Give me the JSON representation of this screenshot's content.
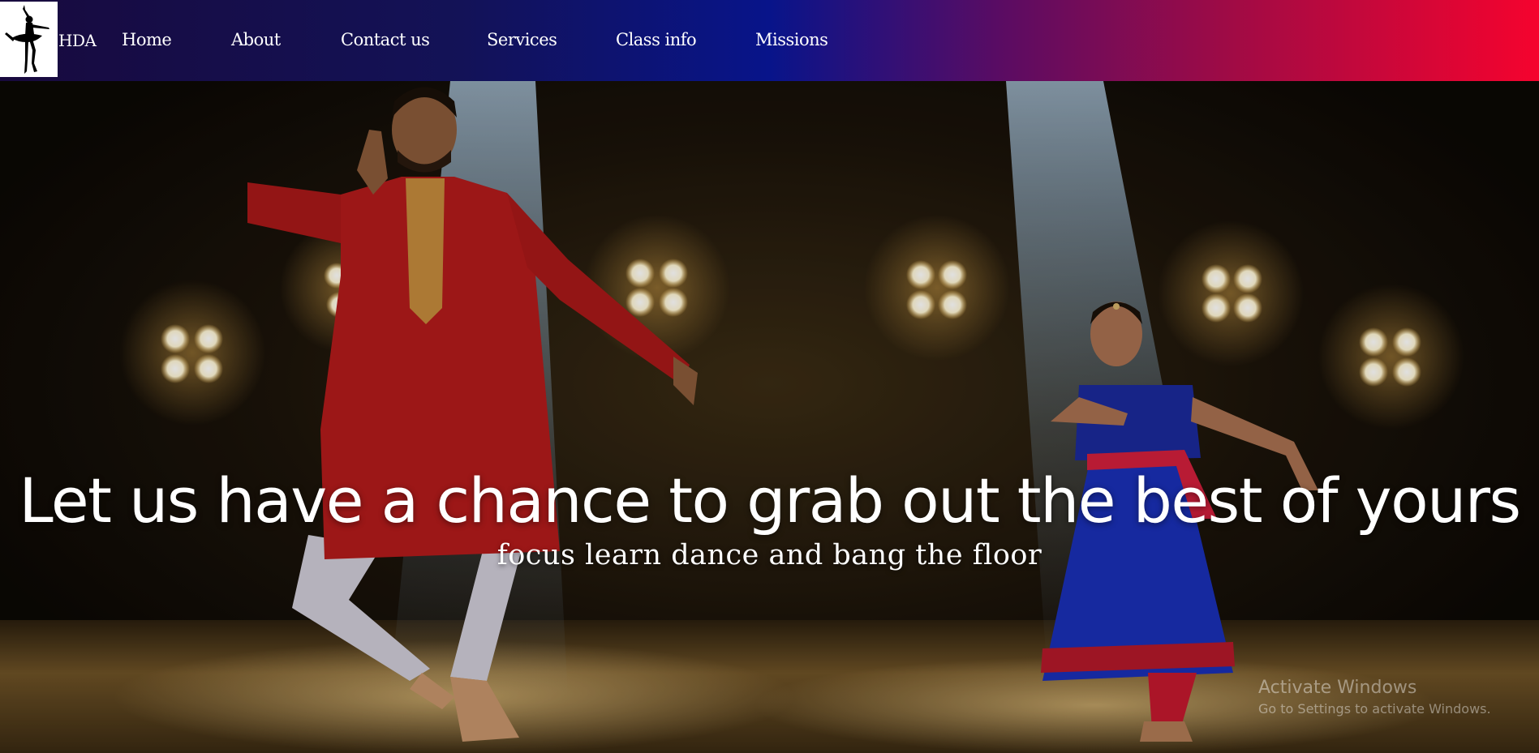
{
  "brand": {
    "logo_icon": "ballerina-silhouette-icon",
    "name": "HDA"
  },
  "nav": {
    "items": [
      {
        "label": "Home"
      },
      {
        "label": "About"
      },
      {
        "label": "Contact us"
      },
      {
        "label": "Services"
      },
      {
        "label": "Class info"
      },
      {
        "label": "Missions"
      }
    ]
  },
  "hero": {
    "image": "stage-dancers-photo",
    "headline": "Let us have a chance to grab out the best of yours",
    "subheadline": "focus learn dance and bang the floor"
  },
  "os_watermark": {
    "title": "Activate Windows",
    "subtitle": "Go to Settings to activate Windows."
  },
  "colors": {
    "nav_gradient_start": "#180a3e",
    "nav_gradient_mid": "#08148a",
    "nav_gradient_end": "#f5032e",
    "text": "#ffffff"
  }
}
